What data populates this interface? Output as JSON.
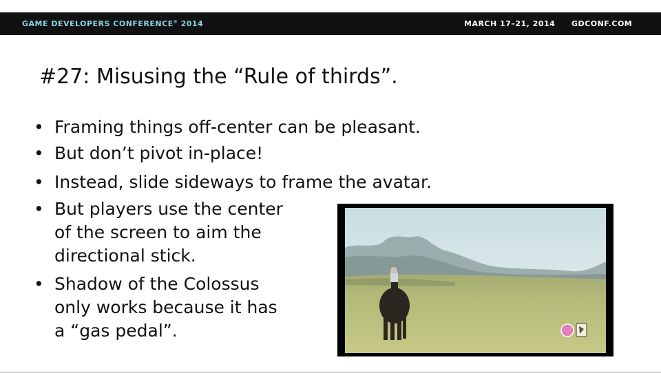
{
  "header": {
    "conference": "GAME DEVELOPERS CONFERENCE",
    "year": "2014",
    "dates": "MARCH 17–21, 2014",
    "site": "GDCONF.COM",
    "accent_color": "#8ad3e6",
    "bar_color": "#111111"
  },
  "slide": {
    "title": "#27: Misusing the “Rule of thirds”.",
    "bullets": [
      {
        "lines": [
          "Framing things off-center can be pleasant."
        ]
      },
      {
        "lines": [
          "But don’t pivot in-place!"
        ]
      },
      {
        "lines": [
          "Instead, slide sideways to frame the avatar."
        ]
      },
      {
        "lines": [
          "But players use the center",
          "of the screen to aim the",
          "directional stick."
        ]
      },
      {
        "lines": [
          "Shadow of the Colossus",
          "only works because it has",
          "a “gas pedal”."
        ]
      }
    ],
    "bullet_glyph": "•"
  }
}
